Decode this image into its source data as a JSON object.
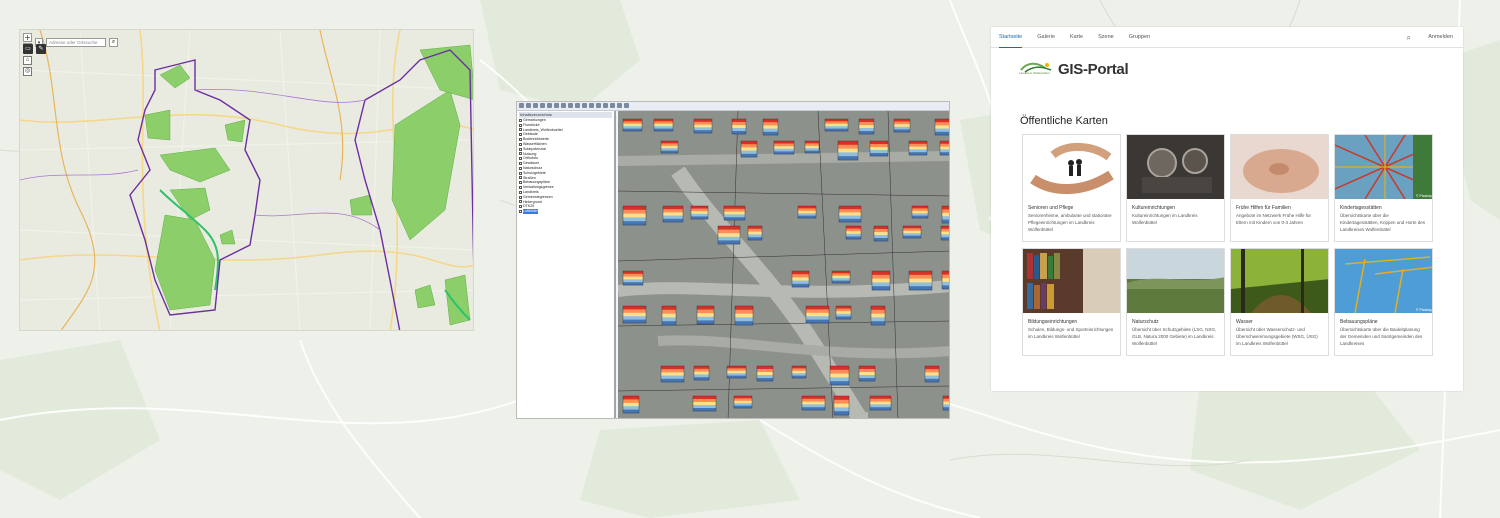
{
  "map_panel": {
    "search_placeholder": "Adresse oder Ortssuche",
    "zoom_in": "+",
    "zoom_out": "−"
  },
  "gis_desktop": {
    "toc_title": "Inhaltsverzeichnis",
    "layers": [
      "Gemarkungen",
      "Flurstücke",
      "Landkreis_Wolfenbuettel",
      "Gebäude",
      "Bodenrichtwerte",
      "Wasserflächen",
      "Solarpotenzial",
      "Nutzung",
      "Orthofoto",
      "Gewässer",
      "Naturschutz",
      "Schutzgebiete",
      "Straßen",
      "Bebauungspläne",
      "Verwaltungsgrenze",
      "Landkreis",
      "Gemeindegrenzen",
      "Hintergrund",
      "DTK25",
      "Luftbilder"
    ],
    "selected_layer": "Luftbilder"
  },
  "portal": {
    "nav": [
      "Startseite",
      "Galerie",
      "Karte",
      "Szene",
      "Gruppen"
    ],
    "active_nav": "Startseite",
    "signin": "Anmelden",
    "title": "GIS-Portal",
    "logo_text": "Landkreis Wolfenbüttel",
    "section_title": "Öffentliche Karten",
    "cards": [
      {
        "title": "Senioren und Pflege",
        "desc": "Seniorenheime, ambulante und stationäre Pflegeeinrichtungen im Landkreis Wolfenbüttel",
        "theme": "hands"
      },
      {
        "title": "Kultureinrichtungen",
        "desc": "Kultureinrichtungen im Landkreis Wolfenbüttel",
        "theme": "projector"
      },
      {
        "title": "Frühe Hilfen für Familien",
        "desc": "Angebote im Netzwerk Frühe Hilfe für Eltern mit Kindern von 0-3 Jahren",
        "theme": "baby"
      },
      {
        "title": "Kindertagesstätten",
        "desc": "Übersichtskarte über die Kindertagesstätten, Krippen und Horte des Landkreises Wolfenbüttel",
        "theme": "climbing",
        "credit": "© Pixabay"
      },
      {
        "title": "Bildungseinrichtungen",
        "desc": "Schulen, Bildungs- und Sporteinrichtungen im Landkreis Wolfenbüttel",
        "theme": "books"
      },
      {
        "title": "Naturschutz",
        "desc": "Übersicht über Schutzgebiete (LSG, NSG, GLB, Natura 2000 Gebiete) im Landkreis Wolfenbüttel",
        "theme": "landscape"
      },
      {
        "title": "Wasser",
        "desc": "Übersicht über Wasserschutz- und Überschwemmungsgebiete (WSG, ÜSG) im Landkreis Wolfenbüttel",
        "theme": "forest"
      },
      {
        "title": "Bebauungspläne",
        "desc": "Übersichtskarte über die Bauleitplanung der Gemeinden und Samtgemeinden des Landkreises",
        "theme": "crane",
        "credit": "© Pixabay"
      }
    ]
  },
  "colors": {
    "accent": "#1c6aa8",
    "boundary": "#6b2fa0",
    "forest_green": "#7cc560"
  }
}
